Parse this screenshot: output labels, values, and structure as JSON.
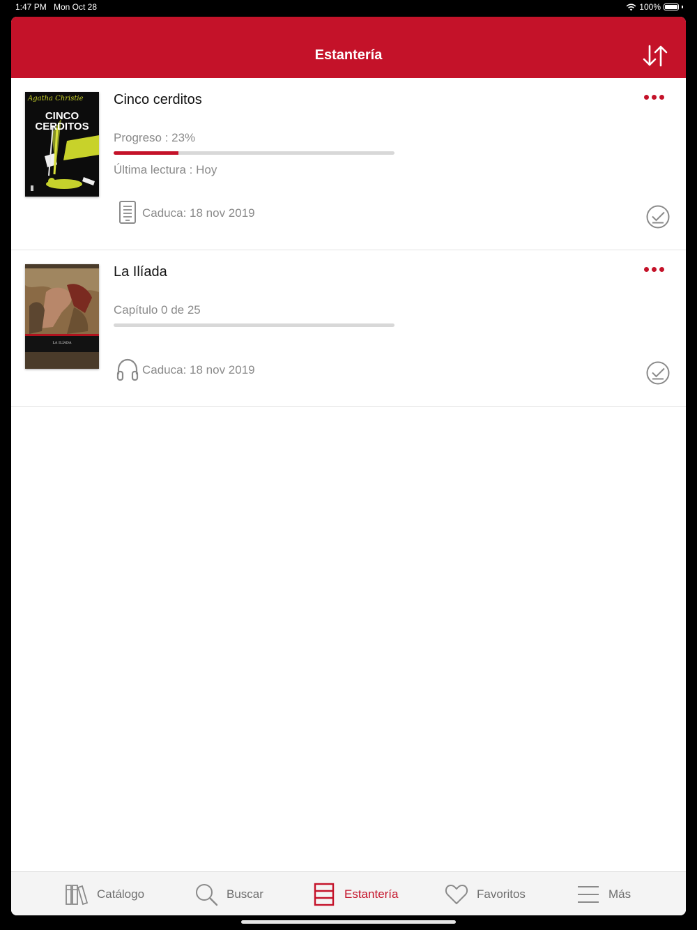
{
  "status_bar": {
    "time": "1:47 PM",
    "date": "Mon Oct 28",
    "battery": "100%"
  },
  "header": {
    "title": "Estantería"
  },
  "books": [
    {
      "title": "Cinco cerditos",
      "cover_author": "Agatha Christie",
      "cover_title_line1": "CINCO",
      "cover_title_line2": "CERDITOS",
      "progress_text": "Progreso : 23%",
      "progress_fraction": 0.23,
      "last_read": "Última lectura : Hoy",
      "format_icon": "ebook-icon",
      "expiry": "Caduca: 18 nov 2019"
    },
    {
      "title": "La Ilíada",
      "cover_title": "LA ILÍADA",
      "chapter_text": "Capítulo 0 de 25",
      "progress_fraction": 0,
      "format_icon": "headphones-icon",
      "expiry": "Caduca: 18 nov 2019"
    }
  ],
  "tabs": [
    {
      "label": "Catálogo",
      "icon": "catalog-books-icon",
      "active": false
    },
    {
      "label": "Buscar",
      "icon": "search-icon",
      "active": false
    },
    {
      "label": "Estantería",
      "icon": "shelf-icon",
      "active": true
    },
    {
      "label": "Favoritos",
      "icon": "heart-icon",
      "active": false
    },
    {
      "label": "Más",
      "icon": "menu-icon",
      "active": false
    }
  ],
  "colors": {
    "brand": "#c41229",
    "muted_text": "#8a8a8a",
    "progress_track": "#d8d8d8"
  }
}
